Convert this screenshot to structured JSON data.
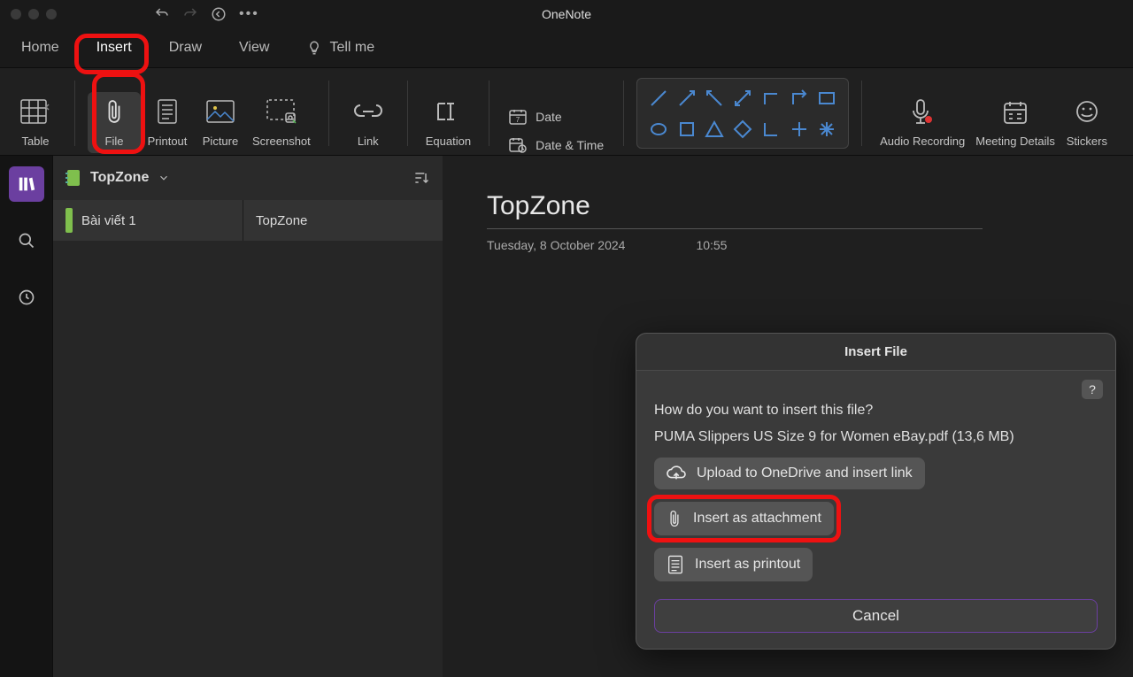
{
  "app": {
    "title": "OneNote"
  },
  "tabs": {
    "home": "Home",
    "insert": "Insert",
    "draw": "Draw",
    "view": "View",
    "tellme": "Tell me"
  },
  "ribbon": {
    "table": "Table",
    "file": "File",
    "printout": "Printout",
    "picture": "Picture",
    "screenshot": "Screenshot",
    "link": "Link",
    "equation": "Equation",
    "date": "Date",
    "datetime": "Date & Time",
    "audio": "Audio Recording",
    "meeting": "Meeting Details",
    "stickers": "Stickers"
  },
  "notebook": {
    "name": "TopZone",
    "section": "Bài viết 1",
    "page": "TopZone"
  },
  "page": {
    "title": "TopZone",
    "date": "Tuesday, 8 October 2024",
    "time": "10:55"
  },
  "dialog": {
    "title": "Insert File",
    "question": "How do you want to insert this file?",
    "filename": "PUMA Slippers US Size 9 for Women  eBay.pdf (13,6 MB)",
    "opt_upload": "Upload to OneDrive and insert link",
    "opt_attach": "Insert as attachment",
    "opt_printout": "Insert as printout",
    "cancel": "Cancel",
    "help": "?"
  }
}
